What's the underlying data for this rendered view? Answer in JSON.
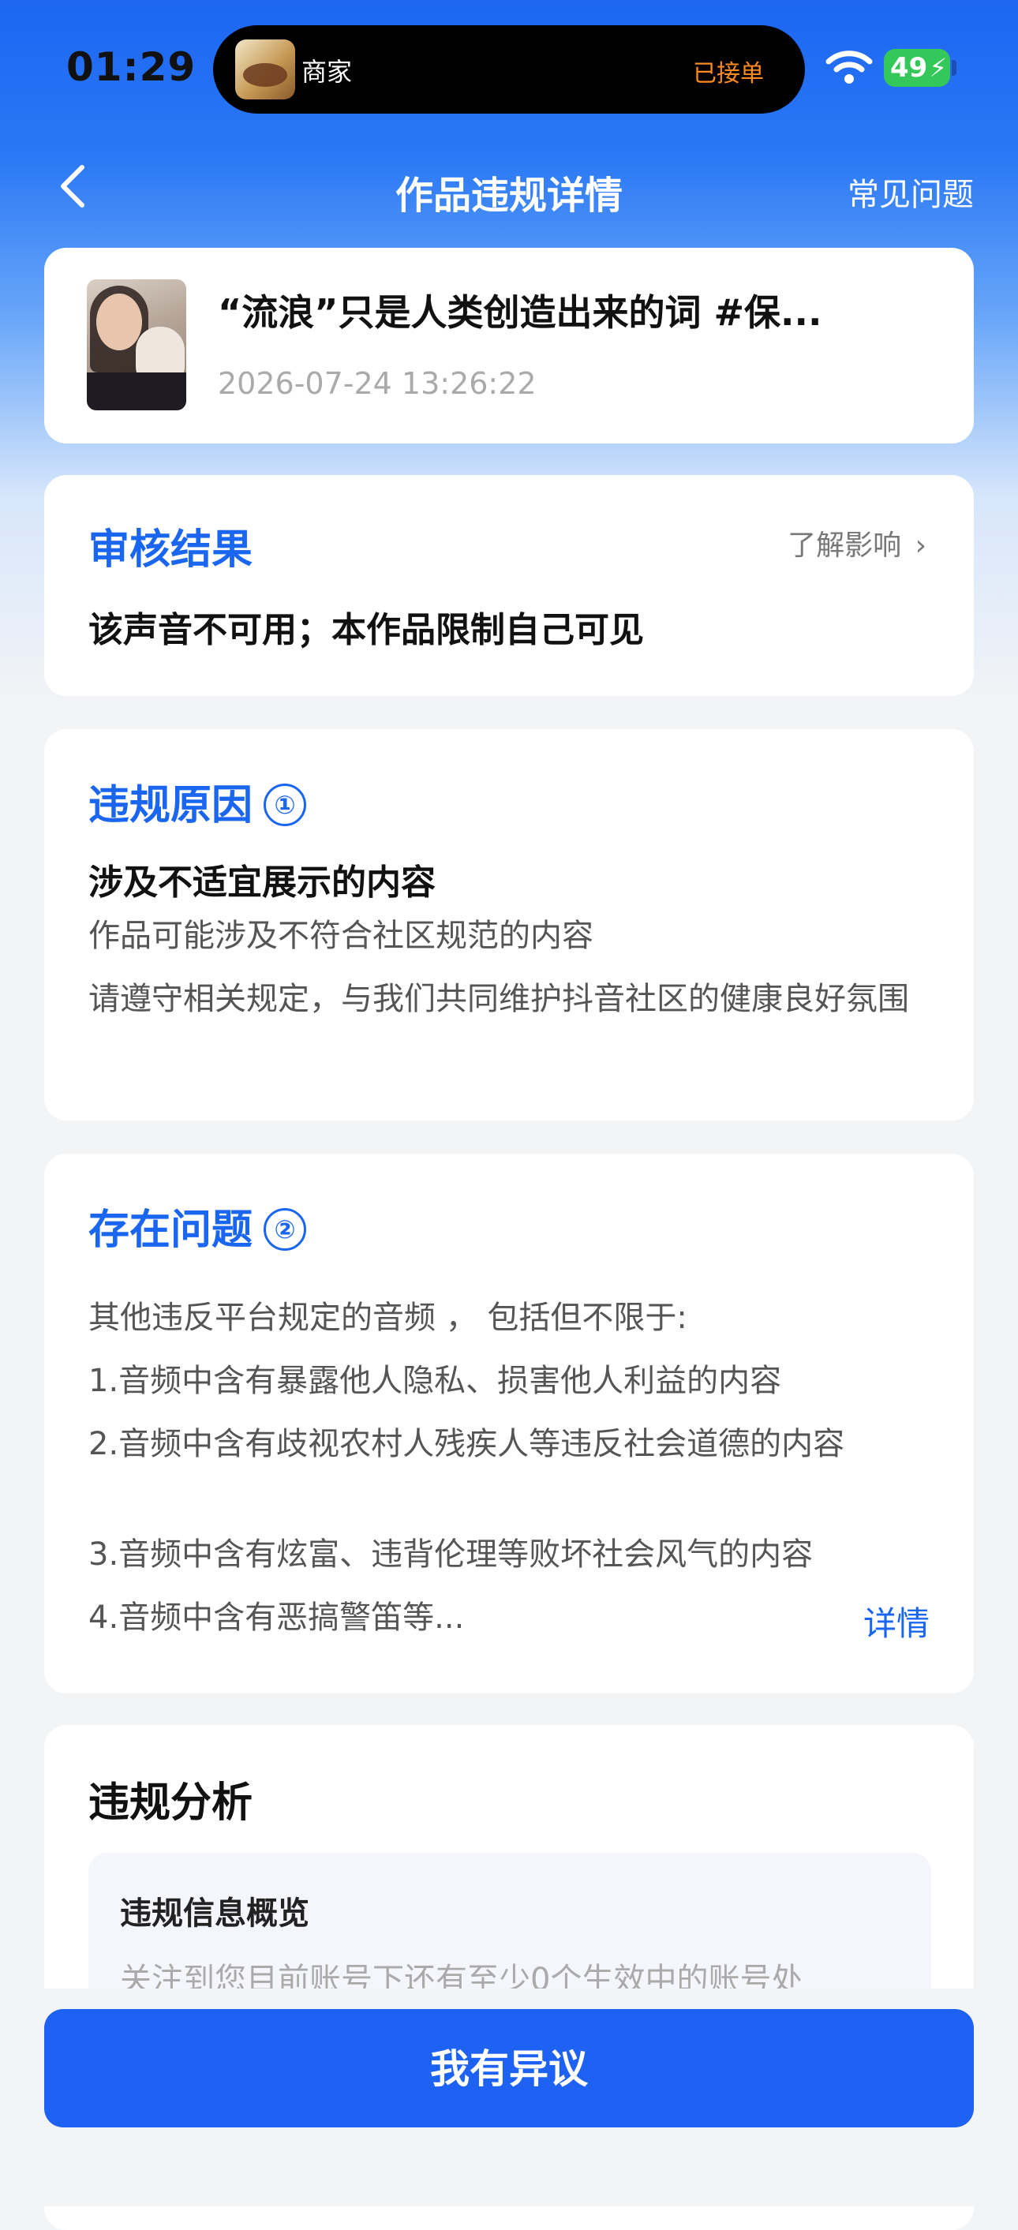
{
  "status_bar": {
    "time": "01:29",
    "island": {
      "merchant": "商家",
      "status": "已接单"
    },
    "battery": "49"
  },
  "nav": {
    "title": "作品违规详情",
    "faq": "常见问题"
  },
  "video": {
    "title": "“流浪”只是人类创造出来的词 #保...",
    "time": "2026-07-24 13:26:22"
  },
  "review": {
    "title": "审核结果",
    "learn_more": "了解影响",
    "result": "该声音不可用；本作品限制自己可见"
  },
  "reason": {
    "title": "违规原因",
    "badge": "①",
    "heading": "涉及不适宜展示的内容",
    "lines": [
      "作品可能涉及不符合社区规范的内容",
      "请遵守相关规定，与我们共同维护抖音社区的健康良好氛围"
    ]
  },
  "issues": {
    "title": "存在问题",
    "badge": "②",
    "intro": "其他违反平台规定的音频 ， 包括但不限于:",
    "items": [
      "1.音频中含有暴露他人隐私、损害他人利益的内容",
      "2.音频中含有歧视农村人残疾人等违反社会道德的内容",
      "3.音频中含有炫富、违背伦理等败坏社会风气的内容",
      "4.音频中含有恶搞警笛等..."
    ],
    "detail_link": "详情"
  },
  "analysis": {
    "title": "违规分析",
    "overview_title": "违规信息概览",
    "overview_text": "关注到您目前账号下还有至少0个生效中的账号处"
  },
  "footer": {
    "appeal_button": "我有异议"
  },
  "colors": {
    "accent": "#1a66f0",
    "button": "#1e62f3",
    "island_status": "#ff8a1e",
    "battery": "#34c759"
  }
}
